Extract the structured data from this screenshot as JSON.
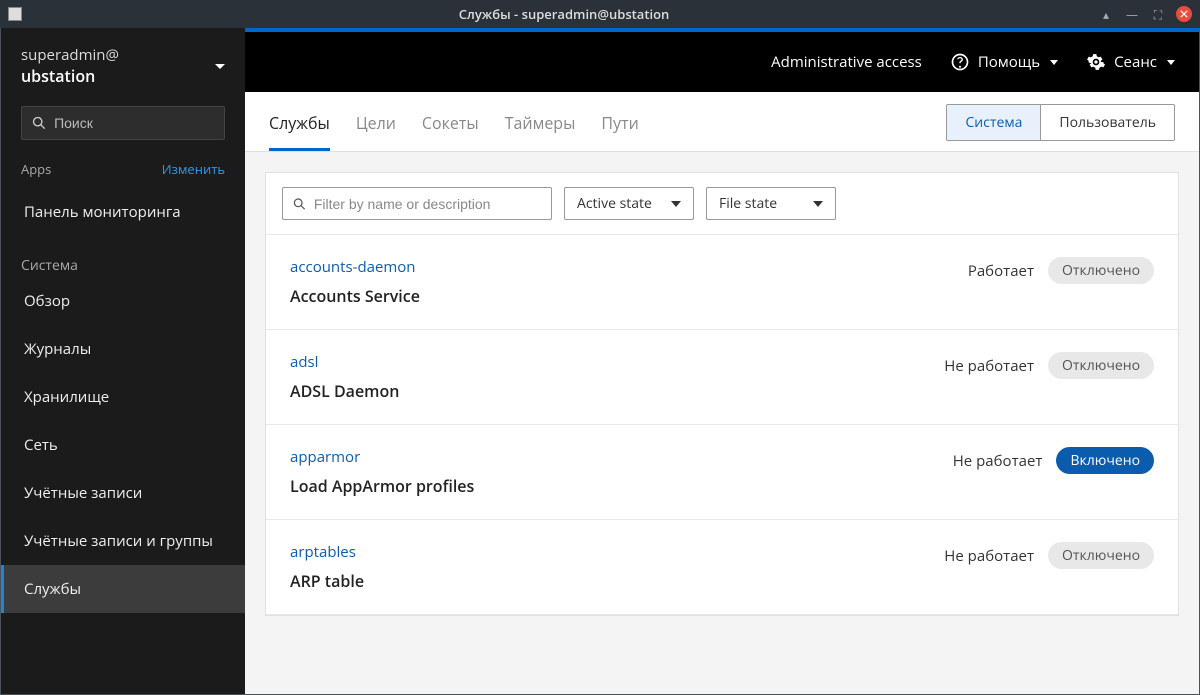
{
  "window": {
    "title": "Службы - superadmin@ubstation"
  },
  "sidebar": {
    "user": "superadmin@",
    "host": "ubstation",
    "search_placeholder": "Поиск",
    "apps_label": "Apps",
    "apps_edit": "Изменить",
    "system_label": "Система",
    "items": {
      "dashboard": "Панель мониторинга",
      "overview": "Обзор",
      "logs": "Журналы",
      "storage": "Хранилище",
      "network": "Сеть",
      "accounts": "Учётные записи",
      "accounts_groups": "Учётные записи и группы",
      "services": "Службы"
    }
  },
  "topbar": {
    "admin_access": "Administrative access",
    "help": "Помощь",
    "session": "Сеанс"
  },
  "tabs": {
    "services": "Службы",
    "targets": "Цели",
    "sockets": "Сокеты",
    "timers": "Таймеры",
    "paths": "Пути"
  },
  "segmented": {
    "system": "Система",
    "user": "Пользователь"
  },
  "filters": {
    "text_placeholder": "Filter by name or description",
    "active_state": "Active state",
    "file_state": "File state"
  },
  "status_labels": {
    "running": "Работает",
    "not_running": "Не работает",
    "enabled": "Включено",
    "disabled": "Отключено"
  },
  "services": [
    {
      "id": "accounts-daemon",
      "desc": "Accounts Service",
      "status": "Работает",
      "enabled": false
    },
    {
      "id": "adsl",
      "desc": "ADSL Daemon",
      "status": "Не работает",
      "enabled": false
    },
    {
      "id": "apparmor",
      "desc": "Load AppArmor profiles",
      "status": "Не работает",
      "enabled": true
    },
    {
      "id": "arptables",
      "desc": "ARP table",
      "status": "Не работает",
      "enabled": false
    }
  ]
}
